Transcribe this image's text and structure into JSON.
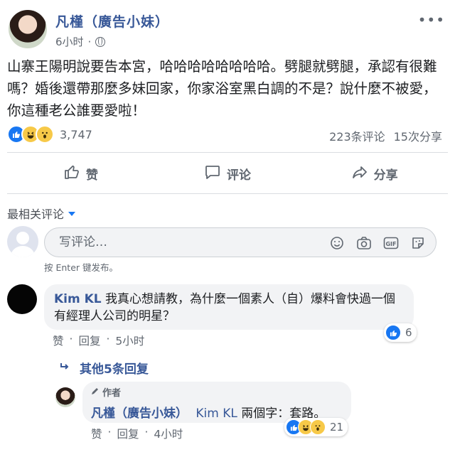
{
  "post": {
    "author": "凡槿（廣告小妹）",
    "time": "6小时",
    "more_glyph": "•••",
    "text": "山寨王陽明說要告本宮，哈哈哈哈哈哈哈哈。劈腿就劈腿，承認有很難嗎？婚後還帶那麼多妹回家，你家浴室黑白調的不是？說什麼不被愛，你這種老公誰要愛啦！",
    "reactions": [
      "like",
      "haha",
      "wow"
    ],
    "reaction_count": "3,747",
    "comment_count": "223条评论",
    "share_count": "15次分享"
  },
  "actions": {
    "like": "赞",
    "comment": "评论",
    "share": "分享"
  },
  "sort_label": "最相关评论",
  "composer": {
    "placeholder": "写评论…",
    "hint": "按 Enter 键发布。",
    "icons": [
      "emoji-icon",
      "camera-icon",
      "gif-icon",
      "sticker-icon"
    ]
  },
  "comments": [
    {
      "name": "Kim KL",
      "text": "我真心想請教，為什麼一個素人（自）爆料會快過一個有經理人公司的明星？",
      "like": "赞",
      "reply": "回复",
      "time": "5小时",
      "reaction_count": "6",
      "more_replies": "其他5条回复",
      "reply_item": {
        "author_tag": "作者",
        "name": "凡槿（廣告小妹）",
        "mention": "Kim KL",
        "text": "兩個字：套路。",
        "like": "赞",
        "reply": "回复",
        "time": "4小时",
        "reaction_count": "21"
      }
    }
  ],
  "colors": {
    "link": "#385898",
    "accent": "#1877f2",
    "muted": "#606770"
  }
}
